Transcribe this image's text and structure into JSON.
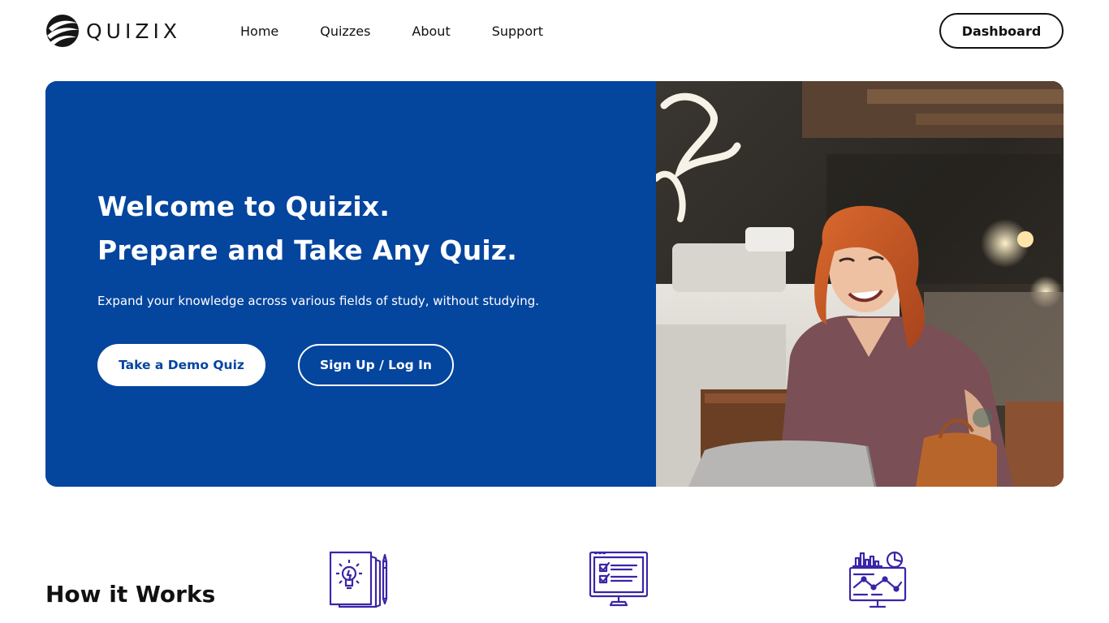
{
  "header": {
    "logo_text": "QUIZIX",
    "logo_icon": "quizix-swirl-logo",
    "nav": [
      "Home",
      "Quizzes",
      "About",
      "Support"
    ],
    "dashboard_label": "Dashboard"
  },
  "hero": {
    "title_line1": "Welcome to Quizix.",
    "title_line2": "Prepare and Take Any Quiz.",
    "subtitle": "Expand your knowledge across various fields of study, without studying.",
    "demo_button": "Take a Demo Quiz",
    "signup_button": "Sign Up / Log In",
    "background_color": "#04459e",
    "photo": "woman-smiling-at-laptop-in-cafe"
  },
  "how_it_works": {
    "title": "How it Works",
    "icons": [
      "idea-notes-pencil-icon",
      "checklist-monitor-icon",
      "analytics-monitor-icon"
    ],
    "icon_color": "#3b24a8"
  }
}
